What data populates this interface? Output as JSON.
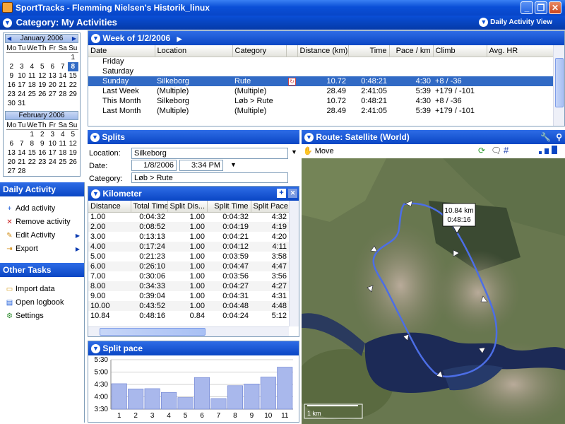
{
  "window": {
    "title": "SportTracks - Flemming Nielsen's Historik_linux",
    "min": "_",
    "max": "❐",
    "close": "✕"
  },
  "category": {
    "title": "Category: My Activities",
    "view_label": "Daily Activity View"
  },
  "calendar": {
    "month1": {
      "name": "January 2006",
      "days_header": [
        "Mo",
        "Tu",
        "We",
        "Th",
        "Fr",
        "Sa",
        "Su"
      ],
      "weeks": [
        [
          "",
          "",
          "",
          "",
          "",
          "",
          "1"
        ],
        [
          "2",
          "3",
          "4",
          "5",
          "6",
          "7",
          "8"
        ],
        [
          "9",
          "10",
          "11",
          "12",
          "13",
          "14",
          "15"
        ],
        [
          "16",
          "17",
          "18",
          "19",
          "20",
          "21",
          "22"
        ],
        [
          "23",
          "24",
          "25",
          "26",
          "27",
          "28",
          "29"
        ],
        [
          "30",
          "31",
          "",
          "",
          "",
          "",
          ""
        ]
      ]
    },
    "month2": {
      "name": "February 2006",
      "weeks": [
        [
          "",
          "",
          "1",
          "2",
          "3",
          "4",
          "5"
        ],
        [
          "6",
          "7",
          "8",
          "9",
          "10",
          "11",
          "12"
        ],
        [
          "13",
          "14",
          "15",
          "16",
          "17",
          "18",
          "19"
        ],
        [
          "20",
          "21",
          "22",
          "23",
          "24",
          "25",
          "26"
        ],
        [
          "27",
          "28",
          "",
          "",
          "",
          "",
          ""
        ]
      ]
    },
    "selected": "8"
  },
  "week": {
    "title": "Week of 1/2/2006",
    "columns": [
      "Date",
      "Location",
      "Category",
      "",
      "Distance (km)",
      "Time",
      "Pace / km",
      "Climb",
      "Avg. HR"
    ],
    "rows": [
      {
        "date": "Friday",
        "location": "",
        "category": "",
        "distance": "",
        "time": "",
        "pace": "",
        "climb": "",
        "hr": ""
      },
      {
        "date": "Saturday",
        "location": "",
        "category": "",
        "distance": "",
        "time": "",
        "pace": "",
        "climb": "",
        "hr": ""
      },
      {
        "date": "Sunday",
        "location": "Silkeborg",
        "category": "Rute",
        "distance": "10.72",
        "time": "0:48:21",
        "pace": "4:30",
        "climb": "+8 / -36",
        "hr": "",
        "selected": true
      },
      {
        "date": "Last Week",
        "location": "(Multiple)",
        "category": "(Multiple)",
        "distance": "28.49",
        "time": "2:41:05",
        "pace": "5:39",
        "climb": "+179 / -101",
        "hr": ""
      },
      {
        "date": "This Month",
        "location": "Silkeborg",
        "category": "Løb > Rute",
        "distance": "10.72",
        "time": "0:48:21",
        "pace": "4:30",
        "climb": "+8 / -36",
        "hr": ""
      },
      {
        "date": "Last Month",
        "location": "(Multiple)",
        "category": "(Multiple)",
        "distance": "28.49",
        "time": "2:41:05",
        "pace": "5:39",
        "climb": "+179 / -101",
        "hr": ""
      }
    ]
  },
  "daily": {
    "title": "Daily Activity",
    "items": [
      {
        "label": "Add activity",
        "icon": "add-icon"
      },
      {
        "label": "Remove activity",
        "icon": "remove-icon"
      },
      {
        "label": "Edit Activity",
        "icon": "edit-icon"
      },
      {
        "label": "Export",
        "icon": "export-icon"
      }
    ]
  },
  "other": {
    "title": "Other Tasks",
    "items": [
      {
        "label": "Import data",
        "icon": "folder-icon"
      },
      {
        "label": "Open logbook",
        "icon": "logbook-icon"
      },
      {
        "label": "Settings",
        "icon": "settings-icon"
      }
    ]
  },
  "splits": {
    "title": "Splits",
    "location_label": "Location:",
    "location_value": "Silkeborg",
    "date_label": "Date:",
    "date_value": "1/8/2006",
    "time_value": "3:34 PM",
    "category_label": "Category:",
    "category_value": "Løb > Rute"
  },
  "kilometer": {
    "title": "Kilometer",
    "columns": [
      "Distance",
      "Total Time",
      "Split Dis...",
      "Split Time",
      "Split Pace"
    ],
    "rows": [
      [
        "1.00",
        "0:04:32",
        "1.00",
        "0:04:32",
        "4:32"
      ],
      [
        "2.00",
        "0:08:52",
        "1.00",
        "0:04:19",
        "4:19"
      ],
      [
        "3.00",
        "0:13:13",
        "1.00",
        "0:04:21",
        "4:20"
      ],
      [
        "4.00",
        "0:17:24",
        "1.00",
        "0:04:12",
        "4:11"
      ],
      [
        "5.00",
        "0:21:23",
        "1.00",
        "0:03:59",
        "3:58"
      ],
      [
        "6.00",
        "0:26:10",
        "1.00",
        "0:04:47",
        "4:47"
      ],
      [
        "7.00",
        "0:30:06",
        "1.00",
        "0:03:56",
        "3:56"
      ],
      [
        "8.00",
        "0:34:33",
        "1.00",
        "0:04:27",
        "4:27"
      ],
      [
        "9.00",
        "0:39:04",
        "1.00",
        "0:04:31",
        "4:31"
      ],
      [
        "10.00",
        "0:43:52",
        "1.00",
        "0:04:48",
        "4:48"
      ],
      [
        "10.84",
        "0:48:16",
        "0.84",
        "0:04:24",
        "5:12"
      ]
    ]
  },
  "split_pace": {
    "title": "Split pace"
  },
  "chart_data": {
    "type": "bar",
    "categories": [
      "1",
      "2",
      "3",
      "4",
      "5",
      "6",
      "7",
      "8",
      "9",
      "10",
      "11"
    ],
    "values": [
      4.53,
      4.32,
      4.33,
      4.18,
      3.97,
      4.78,
      3.93,
      4.45,
      4.52,
      4.8,
      5.2
    ],
    "ytick_labels": [
      "3:30",
      "4:00",
      "4:30",
      "5:00",
      "5:30"
    ],
    "ylim": [
      3.5,
      5.5
    ],
    "grid": true,
    "bar_color": "#a9b8ec"
  },
  "route": {
    "title": "Route: Satellite (World)",
    "move_label": "Move",
    "popup_distance": "10.84 km",
    "popup_time": "0:48:16",
    "scale_label": "1 km"
  }
}
